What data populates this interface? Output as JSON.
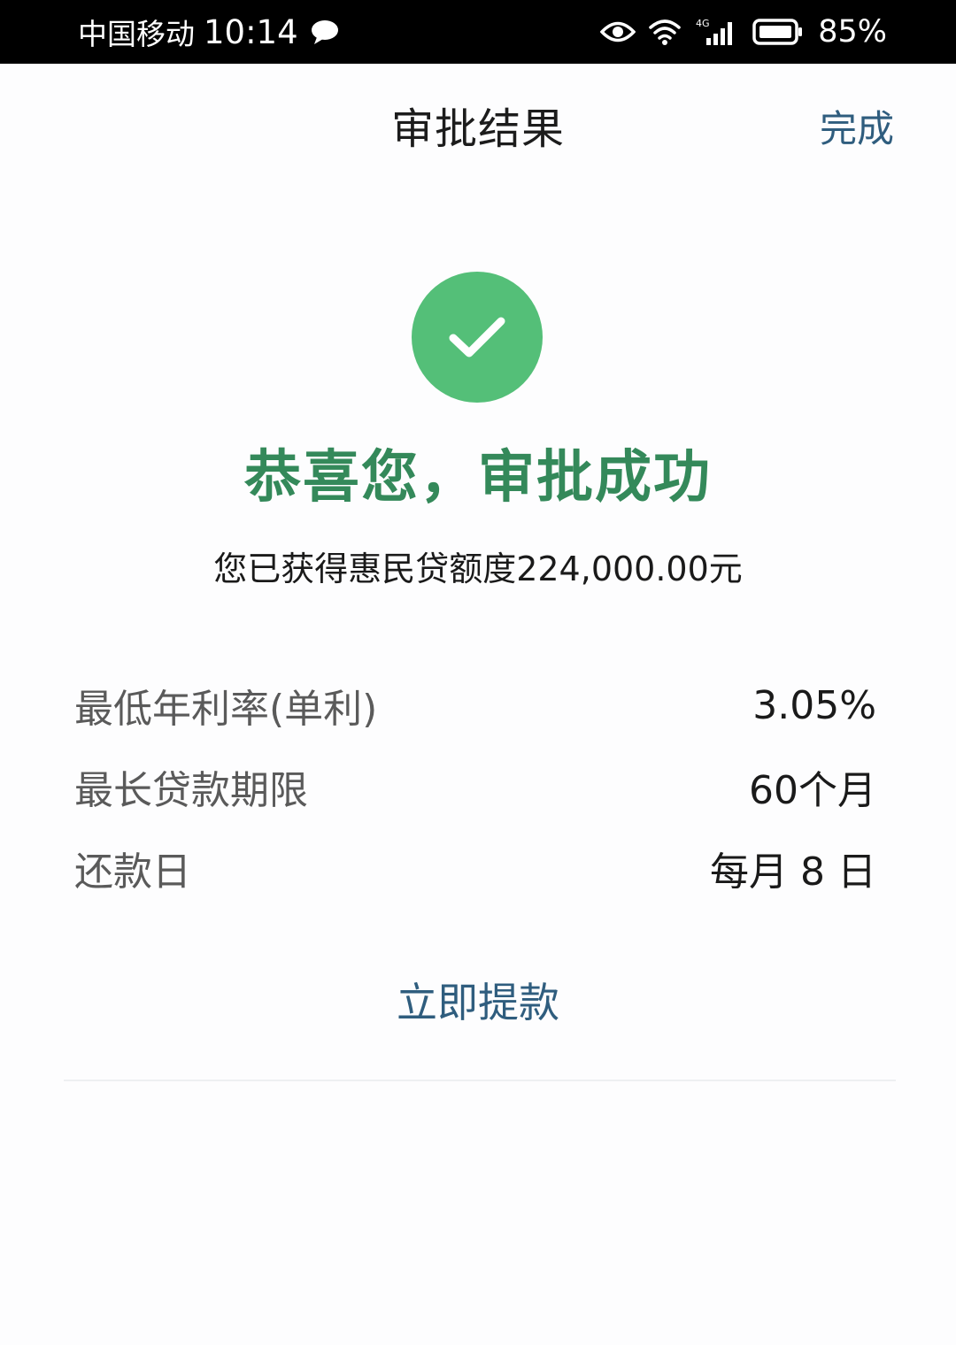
{
  "status_bar": {
    "carrier": "中国移动",
    "time": "10:14",
    "network": "4G",
    "battery": "85%"
  },
  "nav": {
    "title": "审批结果",
    "done_label": "完成"
  },
  "result": {
    "title": "恭喜您，审批成功",
    "quota_text": "您已获得惠民贷额度224,000.00元"
  },
  "details": [
    {
      "label": "最低年利率(单利)",
      "value": "3.05%"
    },
    {
      "label": "最长贷款期限",
      "value": "60个月"
    },
    {
      "label": "还款日",
      "value": "每月 8 日"
    }
  ],
  "actions": {
    "withdraw_label": "立即提款"
  },
  "colors": {
    "success_green": "#54bf78",
    "title_green": "#34895a",
    "link_blue": "#2f5d7e"
  }
}
